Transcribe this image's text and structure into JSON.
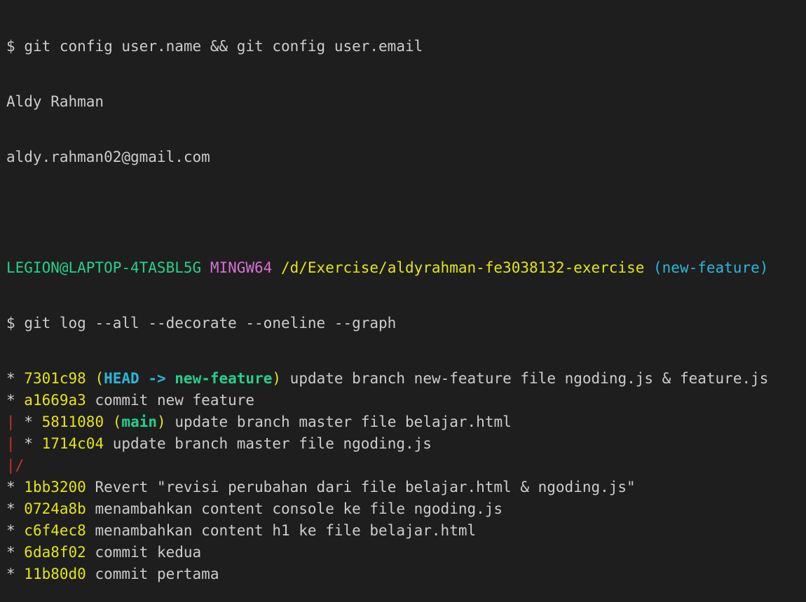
{
  "terminal": {
    "command1": {
      "prompt": "$",
      "text": "git config user.name && git config user.email"
    },
    "output_name": "Aldy Rahman",
    "output_email": "aldy.rahman02@gmail.com",
    "status": {
      "user_host": "LEGION@LAPTOP-4TASBL5G",
      "system": "MINGW64",
      "path": "/d/Exercise/aldyrahman-fe3038132-exercise",
      "branch": "(new-feature)"
    },
    "command2": {
      "prompt": "$",
      "text": "git log --all --decorate --oneline --graph"
    },
    "log": [
      {
        "graph": "* ",
        "graph_color": "plain",
        "hash": "7301c98",
        "refs_open": "(",
        "head": "HEAD -> ",
        "ref": "new-feature",
        "refs_close": ")",
        "message": "update branch new-feature file ngoding.js & feature.js"
      },
      {
        "graph": "* ",
        "graph_color": "plain",
        "hash": "a1669a3",
        "message": "commit new feature"
      },
      {
        "graph": "| * ",
        "graph_color": "red-pipe",
        "hash": "5811080",
        "refs_open": "(",
        "ref": "main",
        "refs_close": ")",
        "message": "update branch master file belajar.html"
      },
      {
        "graph": "| * ",
        "graph_color": "red-pipe",
        "hash": "1714c04",
        "message": "update branch master file ngoding.js"
      },
      {
        "graph": "|/",
        "graph_color": "red-all",
        "is_connector": true
      },
      {
        "graph": "* ",
        "graph_color": "plain",
        "hash": "1bb3200",
        "message": "Revert \"revisi perubahan dari file belajar.html & ngoding.js\""
      },
      {
        "graph": "* ",
        "graph_color": "plain",
        "hash": "0724a8b",
        "message": "menambahkan content console ke file ngoding.js"
      },
      {
        "graph": "* ",
        "graph_color": "plain",
        "hash": "c6f4ec8",
        "message": "menambahkan content h1 ke file belajar.html"
      },
      {
        "graph": "* ",
        "graph_color": "plain",
        "hash": "6da8f02",
        "message": "commit kedua"
      },
      {
        "graph": "* ",
        "graph_color": "plain",
        "hash": "11b80d0",
        "message": "commit pertama"
      }
    ]
  },
  "colors": {
    "background": "#1e1e1e",
    "text": "#cccccc",
    "user_host": "#23d18b",
    "system": "#d670d6",
    "path": "#e5e510",
    "branch": "#29b8db",
    "graph_line": "#cd3131"
  }
}
